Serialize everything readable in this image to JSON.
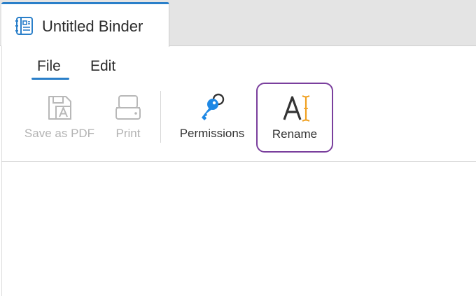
{
  "tab": {
    "title": "Untitled Binder",
    "icon": "binder-icon",
    "accent_color": "#2a7fc9"
  },
  "menu": {
    "items": [
      {
        "label": "File",
        "active": true
      },
      {
        "label": "Edit",
        "active": false
      }
    ]
  },
  "toolbar": {
    "save_pdf": {
      "label": "Save as PDF",
      "icon": "save-pdf-icon",
      "enabled": false
    },
    "print": {
      "label": "Print",
      "icon": "printer-icon",
      "enabled": false
    },
    "permissions": {
      "label": "Permissions",
      "icon": "keys-icon",
      "enabled": true
    },
    "rename": {
      "label": "Rename",
      "icon": "text-cursor-icon",
      "enabled": true,
      "highlight_color": "#7a3f9d"
    }
  }
}
